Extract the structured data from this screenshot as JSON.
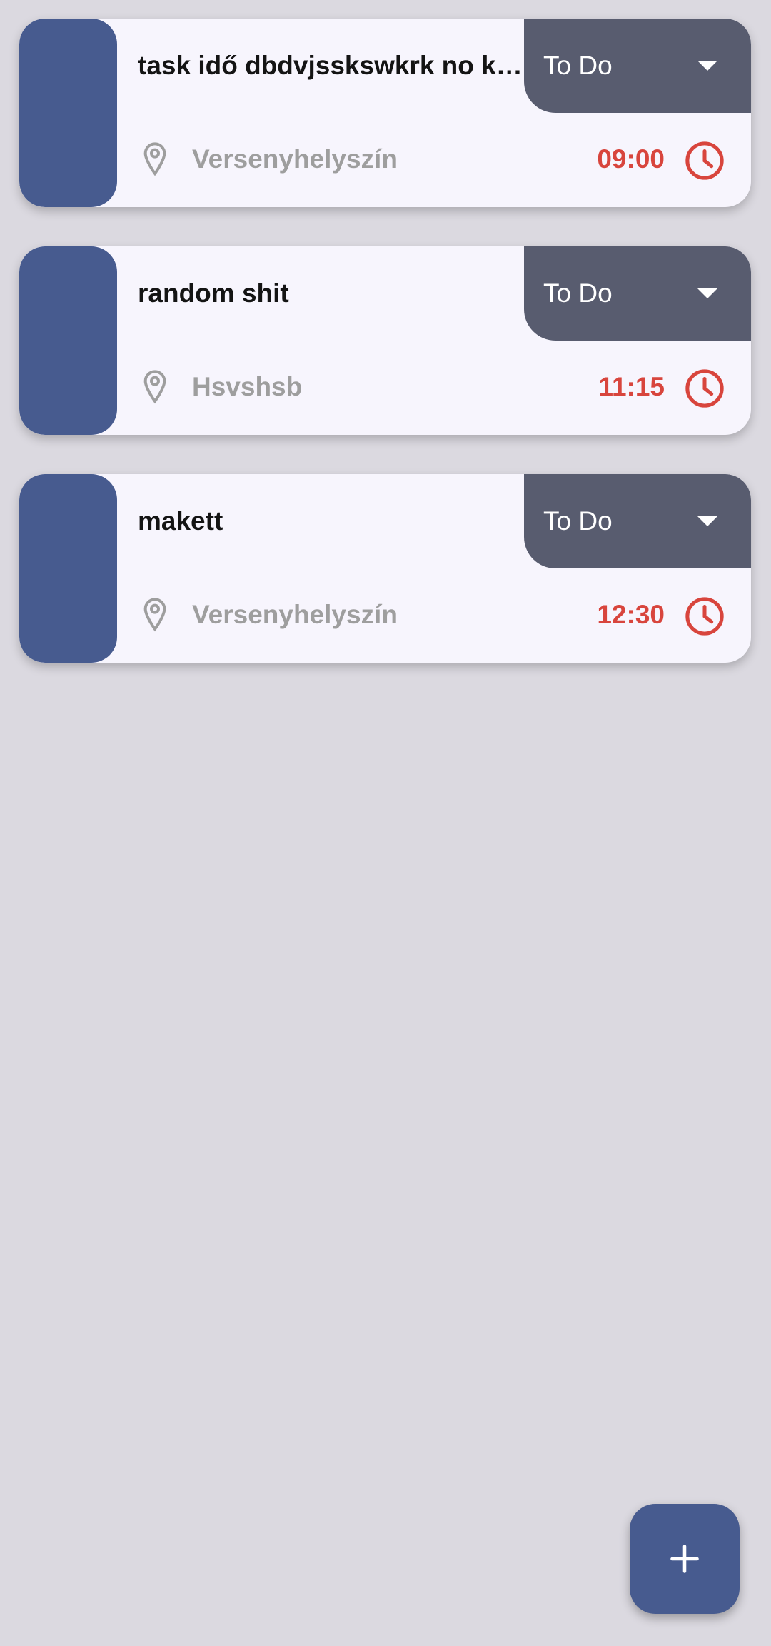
{
  "tasks": [
    {
      "title": "task idő dbdvjsskswkrk no k…",
      "status": "To Do",
      "location": "Versenyhelyszín",
      "time": "09:00"
    },
    {
      "title": "random shit",
      "status": "To Do",
      "location": "Hsvshsb",
      "time": "11:15"
    },
    {
      "title": "makett",
      "status": "To Do",
      "location": "Versenyhelyszín",
      "time": "12:30"
    }
  ],
  "icons": {
    "location": "location-pin-icon",
    "time": "clock-icon",
    "dropdown": "chevron-down-icon",
    "add": "plus-icon"
  },
  "colors": {
    "background": "#dbd9e0",
    "card_background": "#f7f5fd",
    "accent": "#475b8f",
    "status_background": "#585c6f",
    "time_text": "#d8453d",
    "location_text": "#9e9e9e"
  }
}
